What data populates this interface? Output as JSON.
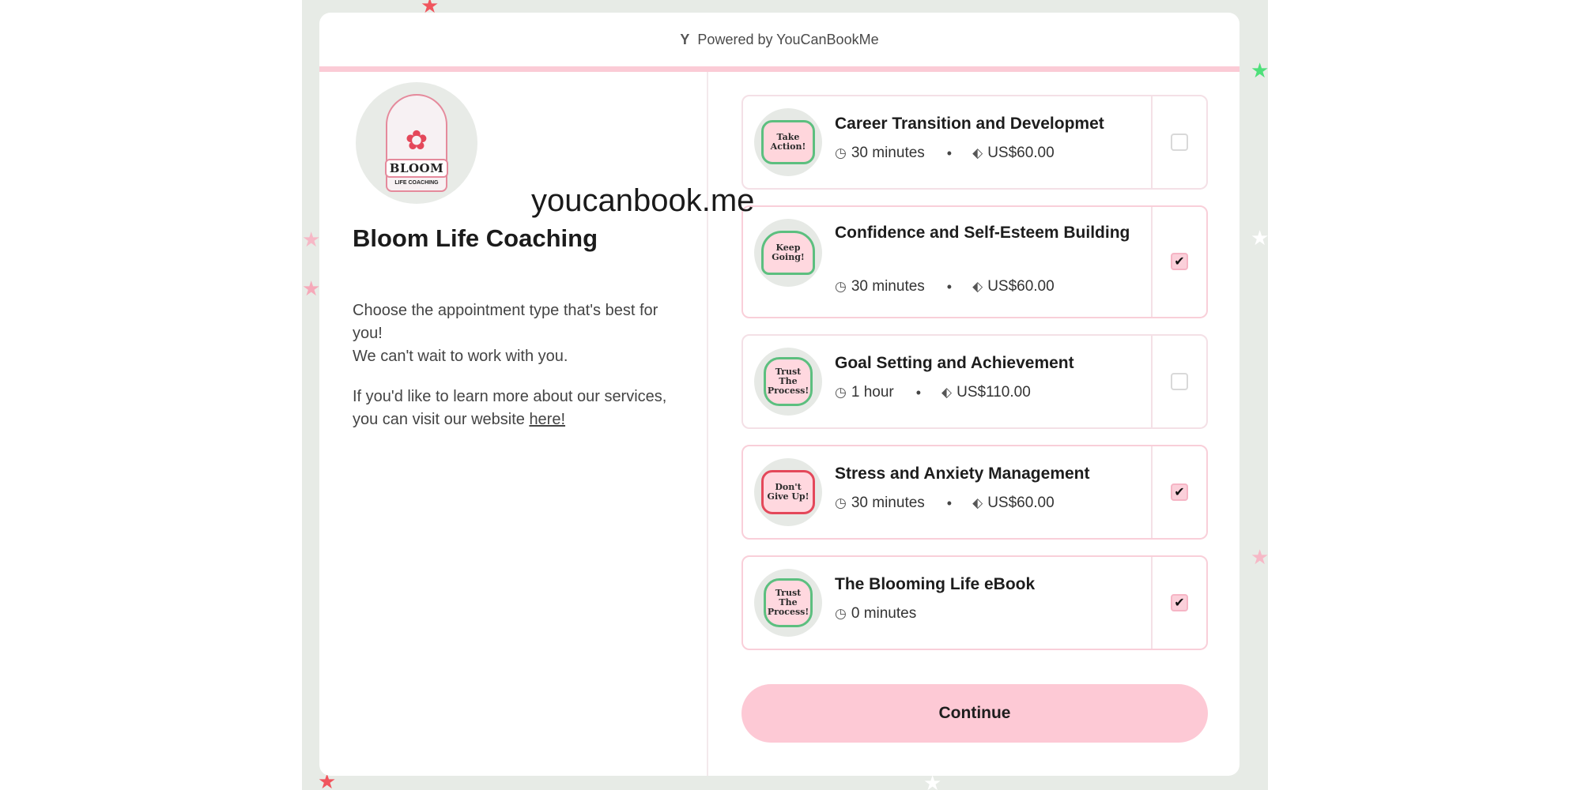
{
  "watermark": "youcanbook.me",
  "powered_by": {
    "icon": "ycbm-logo-icon",
    "text": "Powered by YouCanBookMe"
  },
  "logo": {
    "word": "BLOOM",
    "subtitle": "LIFE COACHING"
  },
  "business": {
    "name": "Bloom Life Coaching"
  },
  "description": {
    "line1": "Choose the appointment type that's best for you!",
    "line2": "We can't wait to work with you.",
    "learn_more": "If you'd like to learn more about our services, you can visit our website ",
    "link_text": "here!"
  },
  "services": [
    {
      "title": "Career Transition and Developmet",
      "duration": "30 minutes",
      "price": "US$60.00",
      "selected": false,
      "sticker": "Take Action!"
    },
    {
      "title": "Confidence and Self-Esteem Building",
      "duration": "30 minutes",
      "price": "US$60.00",
      "selected": true,
      "sticker": "Keep Going!"
    },
    {
      "title": "Goal Setting and Achievement",
      "duration": "1 hour",
      "price": "US$110.00",
      "selected": false,
      "sticker": "Trust The Process!"
    },
    {
      "title": "Stress and Anxiety Management",
      "duration": "30 minutes",
      "price": "US$60.00",
      "selected": true,
      "sticker": "Don't Give Up!"
    },
    {
      "title": "The Blooming Life eBook",
      "duration": "0 minutes",
      "selected": true,
      "sticker": "Trust The Process!"
    }
  ],
  "continue_label": "Continue",
  "colors": {
    "accent_pink": "#fdc9d5",
    "card_border": "#f4e0e6",
    "background": "#e7ebe6"
  }
}
